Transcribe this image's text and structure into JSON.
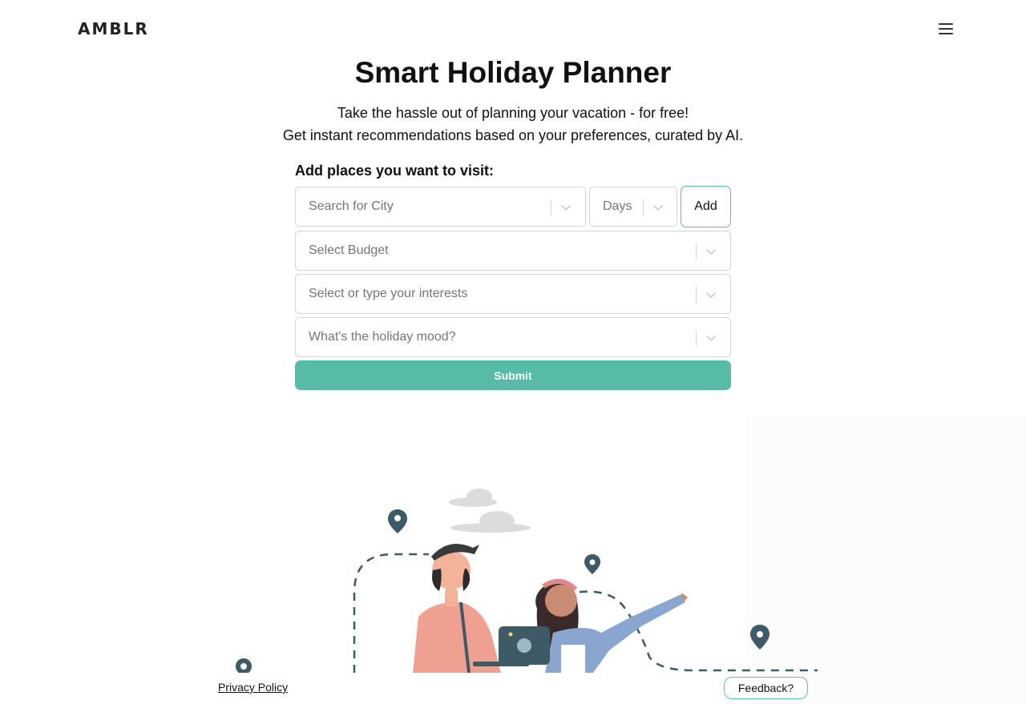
{
  "header": {
    "logo": "AMBLR",
    "menu_icon": "hamburger-menu-icon"
  },
  "hero": {
    "title": "Smart Holiday Planner",
    "subtitle_line1": "Take the hassle out of planning your vacation - for free!",
    "subtitle_line2": "Get instant recommendations based on your preferences, curated by AI."
  },
  "form": {
    "label": "Add places you want to visit:",
    "city_placeholder": "Search for City",
    "days_placeholder": "Days",
    "add_label": "Add",
    "budget_placeholder": "Select Budget",
    "interests_placeholder": "Select or type your interests",
    "mood_placeholder": "What's the holiday mood?",
    "submit_label": "Submit"
  },
  "footer": {
    "privacy_label": "Privacy Policy",
    "feedback_label": "Feedback?"
  },
  "colors": {
    "accent": "#57bba6",
    "accent_border": "#5cbfa8",
    "pin": "#3d5a66",
    "text": "#111111",
    "placeholder": "#757575"
  }
}
